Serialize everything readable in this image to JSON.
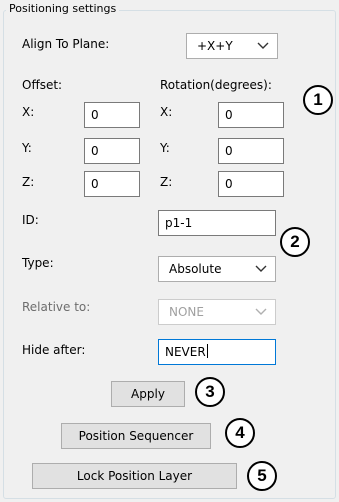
{
  "group_title": "Positioning settings",
  "align": {
    "label": "Align To Plane:",
    "value": "+X+Y"
  },
  "offset": {
    "label": "Offset:",
    "x_label": "X:",
    "y_label": "Y:",
    "z_label": "Z:",
    "x": "0",
    "y": "0",
    "z": "0"
  },
  "rotation": {
    "label": "Rotation(degrees):",
    "x_label": "X:",
    "y_label": "Y:",
    "z_label": "Z:",
    "x": "0",
    "y": "0",
    "z": "0"
  },
  "id": {
    "label": "ID:",
    "value": "p1-1"
  },
  "type": {
    "label": "Type:",
    "value": "Absolute"
  },
  "relative_to": {
    "label": "Relative to:",
    "value": "NONE"
  },
  "hide_after": {
    "label": "Hide after:",
    "value": "NEVER"
  },
  "buttons": {
    "apply": "Apply",
    "position_sequencer": "Position Sequencer",
    "lock_position_layer": "Lock Position Layer"
  },
  "badges": [
    "1",
    "2",
    "3",
    "4",
    "5"
  ]
}
